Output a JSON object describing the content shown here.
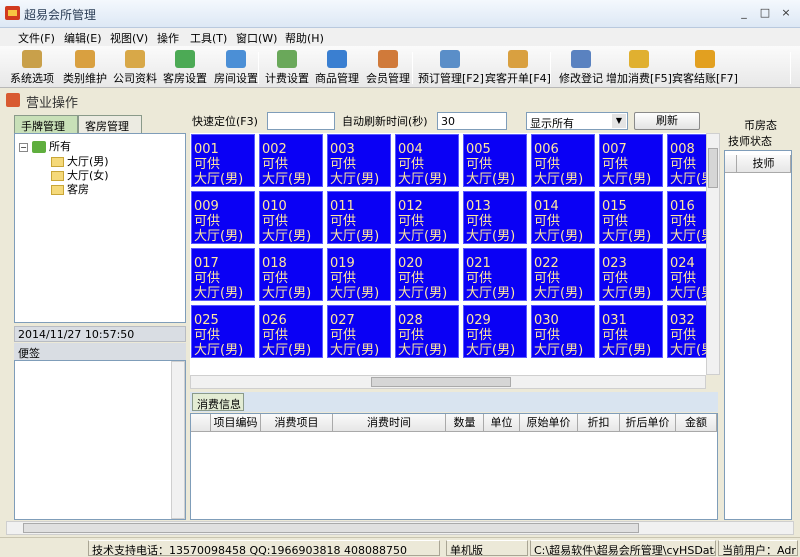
{
  "window": {
    "title": "超易会所管理",
    "min": "_",
    "max": "□",
    "close": "×"
  },
  "menu": [
    "文件(F)",
    "编辑(E)",
    "视图(V)",
    "操作",
    "工具(T)",
    "窗口(W)",
    "帮助(H)"
  ],
  "toolbar": [
    {
      "label": "系统选项",
      "color": "#c9a04a"
    },
    {
      "label": "类别维护",
      "color": "#d9a040"
    },
    {
      "label": "公司资料",
      "color": "#d8a848"
    },
    {
      "label": "客房设置",
      "color": "#4caa55"
    },
    {
      "label": "房间设置",
      "color": "#4b8fd6"
    },
    {
      "label": "计费设置",
      "color": "#6aa85a"
    },
    {
      "label": "商品管理",
      "color": "#3a7fd1"
    },
    {
      "label": "会员管理",
      "color": "#d07a3a"
    },
    {
      "label": "预订管理[F2]",
      "color": "#5a8ec8"
    },
    {
      "label": "宾客开单[F4]",
      "color": "#d9a040"
    },
    {
      "label": "修改登记",
      "color": "#5a82c0"
    },
    {
      "label": "增加消费[F5]",
      "color": "#e0b030"
    },
    {
      "label": "宾客结账[F7]",
      "color": "#e2a020"
    }
  ],
  "section": {
    "title": "营业操作"
  },
  "tabs": {
    "brand": "手牌管理",
    "room": "客房管理"
  },
  "controls": {
    "quick_label": "快速定位(F3)",
    "quick_value": "",
    "refresh_label": "自动刷新时间(秒)",
    "refresh_value": "30",
    "filter_value": "显示所有",
    "refresh_button": "刷新"
  },
  "tree": {
    "root": "所有",
    "children": [
      "大厅(男)",
      "大厅(女)",
      "客房"
    ]
  },
  "datetime": "2014/11/27 10:57:50",
  "notes": {
    "title": "便签"
  },
  "cells": [
    {
      "no": "001",
      "status": "可供",
      "area": "大厅(男)"
    },
    {
      "no": "002",
      "status": "可供",
      "area": "大厅(男)"
    },
    {
      "no": "003",
      "status": "可供",
      "area": "大厅(男)"
    },
    {
      "no": "004",
      "status": "可供",
      "area": "大厅(男)"
    },
    {
      "no": "005",
      "status": "可供",
      "area": "大厅(男)"
    },
    {
      "no": "006",
      "status": "可供",
      "area": "大厅(男)"
    },
    {
      "no": "007",
      "status": "可供",
      "area": "大厅(男)"
    },
    {
      "no": "008",
      "status": "可供",
      "area": "大厅(男)"
    },
    {
      "no": "009",
      "status": "可供",
      "area": "大厅(男)"
    },
    {
      "no": "010",
      "status": "可供",
      "area": "大厅(男)"
    },
    {
      "no": "011",
      "status": "可供",
      "area": "大厅(男)"
    },
    {
      "no": "012",
      "status": "可供",
      "area": "大厅(男)"
    },
    {
      "no": "013",
      "status": "可供",
      "area": "大厅(男)"
    },
    {
      "no": "014",
      "status": "可供",
      "area": "大厅(男)"
    },
    {
      "no": "015",
      "status": "可供",
      "area": "大厅(男)"
    },
    {
      "no": "016",
      "status": "可供",
      "area": "大厅(男)"
    },
    {
      "no": "017",
      "status": "可供",
      "area": "大厅(男)"
    },
    {
      "no": "018",
      "status": "可供",
      "area": "大厅(男)"
    },
    {
      "no": "019",
      "status": "可供",
      "area": "大厅(男)"
    },
    {
      "no": "020",
      "status": "可供",
      "area": "大厅(男)"
    },
    {
      "no": "021",
      "status": "可供",
      "area": "大厅(男)"
    },
    {
      "no": "022",
      "status": "可供",
      "area": "大厅(男)"
    },
    {
      "no": "023",
      "status": "可供",
      "area": "大厅(男)"
    },
    {
      "no": "024",
      "status": "可供",
      "area": "大厅(男)"
    },
    {
      "no": "025",
      "status": "可供",
      "area": "大厅(男)"
    },
    {
      "no": "026",
      "status": "可供",
      "area": "大厅(男)"
    },
    {
      "no": "027",
      "status": "可供",
      "area": "大厅(男)"
    },
    {
      "no": "028",
      "status": "可供",
      "area": "大厅(男)"
    },
    {
      "no": "029",
      "status": "可供",
      "area": "大厅(男)"
    },
    {
      "no": "030",
      "status": "可供",
      "area": "大厅(男)"
    },
    {
      "no": "031",
      "status": "可供",
      "area": "大厅(男)"
    },
    {
      "no": "032",
      "status": "可供",
      "area": "大厅(男)"
    }
  ],
  "consume": {
    "tab": "消费信息",
    "columns": [
      "项目编码",
      "消费项目",
      "消费时间",
      "数量",
      "单位",
      "原始单价",
      "折扣",
      "折后单价",
      "金额"
    ]
  },
  "right": {
    "title1": "币房态",
    "title2": "技师状态",
    "col": "技师"
  },
  "status": {
    "phone": "技术支持电话：13570098458 QQ:1966903818 408088750",
    "mode": "单机版",
    "path": "C:\\超易软件\\超易会所管理\\cyHSData.sys",
    "user": "当前用户：Adr"
  },
  "colors": {
    "cell_bg": "#0a00f5",
    "cell_text": "#ffe7a0",
    "tab_active": "#c8e0b8"
  }
}
